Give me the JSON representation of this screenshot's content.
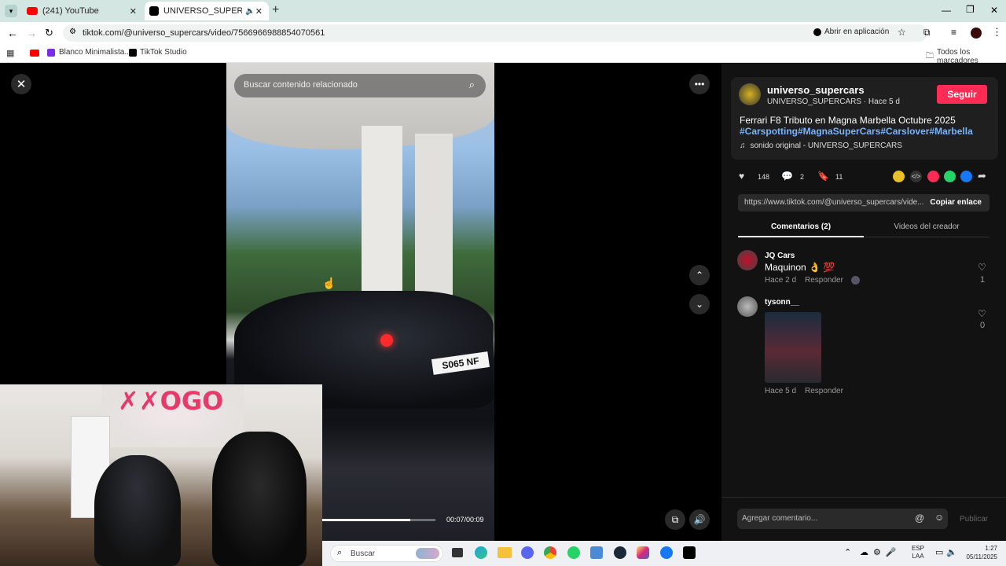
{
  "browser": {
    "tabs": [
      {
        "title": "(241) YouTube"
      },
      {
        "title": "UNIVERSO_SUPERCARS (@"
      }
    ],
    "address": "tiktok.com/@universo_supercars/video/7566966988854070561",
    "open_in_app": "Abrir en aplicación",
    "bookmarks": [
      "Blanco Minimalista...",
      "TikTok Studio"
    ],
    "all_bookmarks": "Todos los marcadores"
  },
  "video": {
    "search_placeholder": "Buscar contenido relacionado",
    "time": "00:07/00:09",
    "progress": 0.78
  },
  "post": {
    "username": "universo_supercars",
    "handle_time": "UNIVERSO_SUPERCARS · Hace 5 d",
    "follow": "Seguir",
    "caption": "Ferrari F8 Tributo en Magna Marbella Octubre 2025",
    "hashtags": "#Carspotting#MagnaSuperCars#Carslover#Marbella",
    "sound": "sonido original - UNIVERSO_SUPERCARS",
    "likes": "148",
    "comments": "2",
    "saves": "11",
    "link": "https://www.tiktok.com/@universo_supercars/vide...",
    "copy_link": "Copiar enlace",
    "tab_comments": "Comentarios (2)",
    "tab_videos": "Videos del creador"
  },
  "comments": [
    {
      "user": "JQ Cars",
      "text": "Maquinon 👌 💯",
      "time": "Hace 2 d",
      "reply": "Responder",
      "likes": "1"
    },
    {
      "user": "tysonn__",
      "text": "",
      "time": "Hace 5 d",
      "reply": "Responder",
      "likes": "0"
    }
  ],
  "composer": {
    "placeholder": "Agregar comentario...",
    "publish": "Publicar"
  },
  "taskbar": {
    "search": "Buscar",
    "lang1": "ESP",
    "lang2": "LAA",
    "time": "1:27",
    "date": "05/11/2025"
  },
  "colors": {
    "accent": "#fe2c55",
    "hashtag": "#78b4ff"
  }
}
